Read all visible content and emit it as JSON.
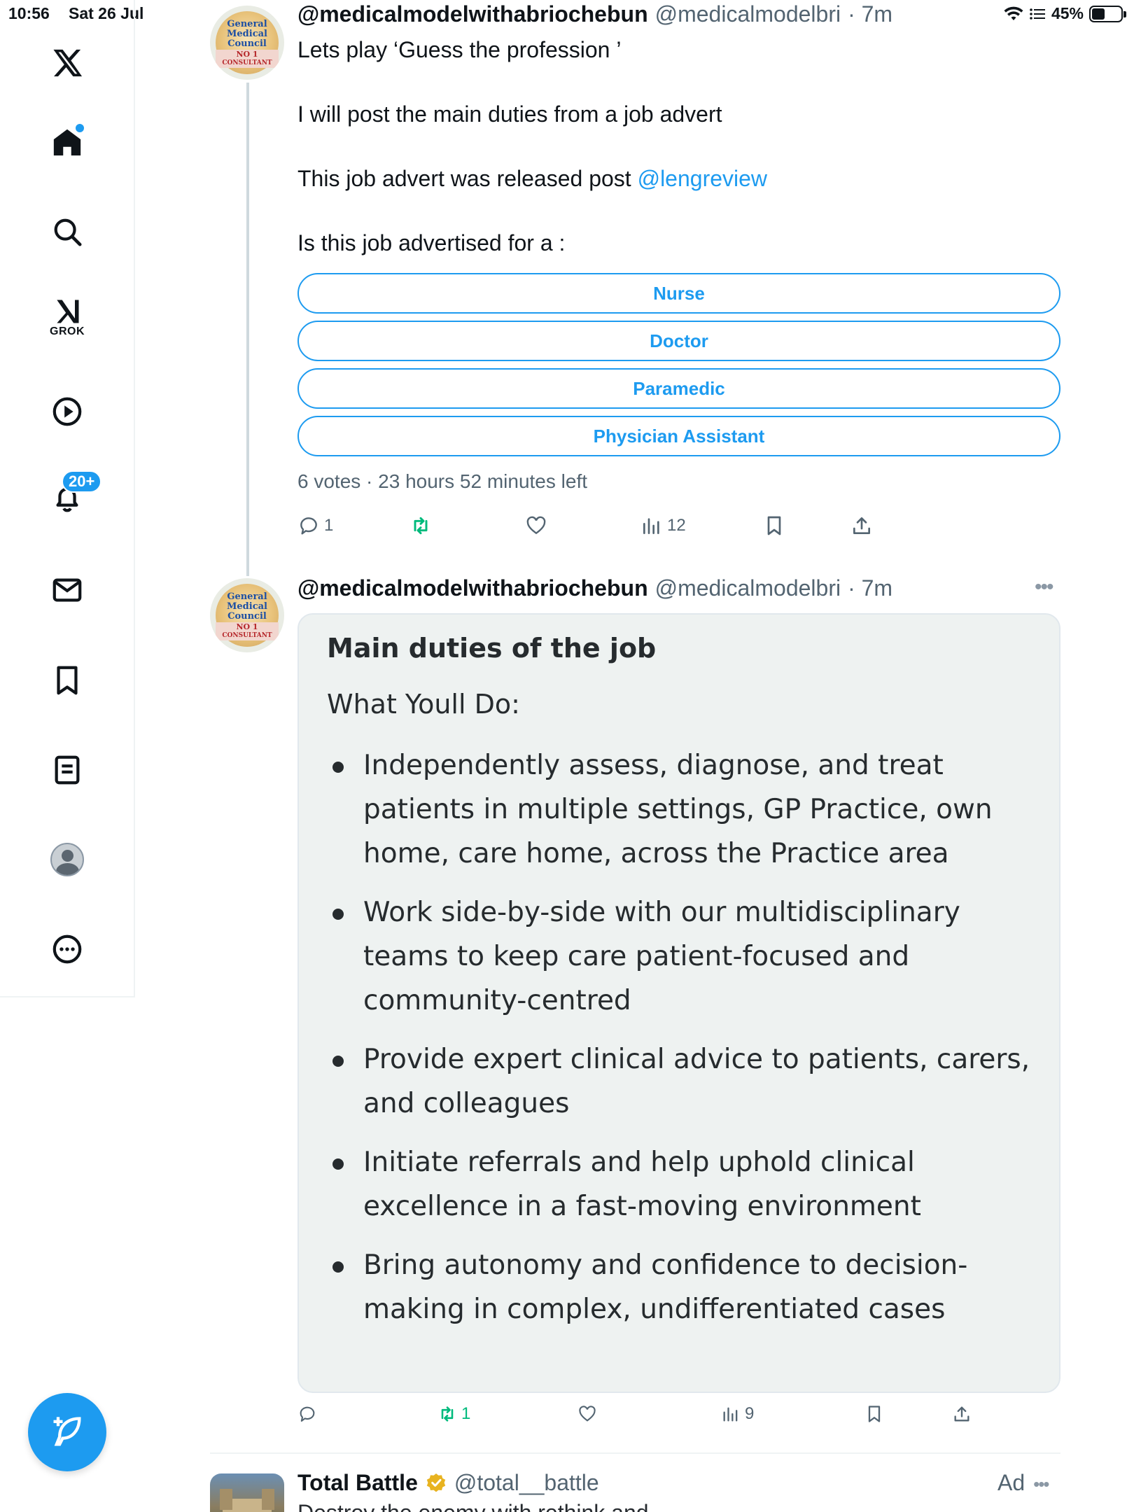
{
  "status_bar": {
    "time": "10:56",
    "date": "Sat 26 Jul",
    "battery_percent": "45%",
    "battery_level": 0.45
  },
  "sidebar": {
    "grok_label": "GROK",
    "notifications_badge": "20+"
  },
  "thread": {
    "tweet1": {
      "author_name": "@medicalmodelwithabriochebun",
      "author_handle": "@medicalmodelbri",
      "time": "· 7m",
      "lines": [
        "Lets play ‘Guess the profession ’",
        "I will post the main duties from a job advert"
      ],
      "line3_text": "This job advert was released post",
      "line3_mention": "@lengreview",
      "line4": "Is this job advertised for a :",
      "poll_options": [
        "Nurse",
        "Doctor",
        "Paramedic",
        "Physician Assistant"
      ],
      "poll_meta": "6 votes · 23 hours 52 minutes left",
      "actions": {
        "replies": "1",
        "retweets": "",
        "likes": "",
        "views": "12"
      }
    },
    "tweet2": {
      "author_name": "@medicalmodelwithabriochebun",
      "author_handle": "@medicalmodelbri",
      "time": "· 7m",
      "card": {
        "title": "Main duties of the job",
        "subtitle": "What Youll Do:",
        "bullets": [
          "Independently assess, diagnose, and treat patients in multiple settings, GP Practice, own home, care home, across the Practice area",
          "Work side-by-side with our multidisciplinary teams to keep care patient-focused and community-centred",
          "Provide expert clinical advice to patients, carers, and colleagues",
          "Initiate referrals and help uphold clinical excellence in a fast-moving environment",
          "Bring autonomy and confidence to decision-making in complex, undifferentiated cases"
        ]
      },
      "actions": {
        "replies": "",
        "retweets": "1",
        "likes": "",
        "views": "9"
      }
    },
    "ad": {
      "author_name": "Total Battle",
      "author_handle": "@total__battle",
      "label": "Ad",
      "text_preview": "Destroy the enemy with rethink and"
    }
  },
  "avatar_logo_text": [
    "General",
    "Medical",
    "Council",
    "NO 1",
    "CONSULTANT"
  ],
  "colors": {
    "accent": "#1d9bf0",
    "retweet_green": "#00ba7c",
    "muted": "#536471",
    "card_bg": "#eef2f1"
  }
}
